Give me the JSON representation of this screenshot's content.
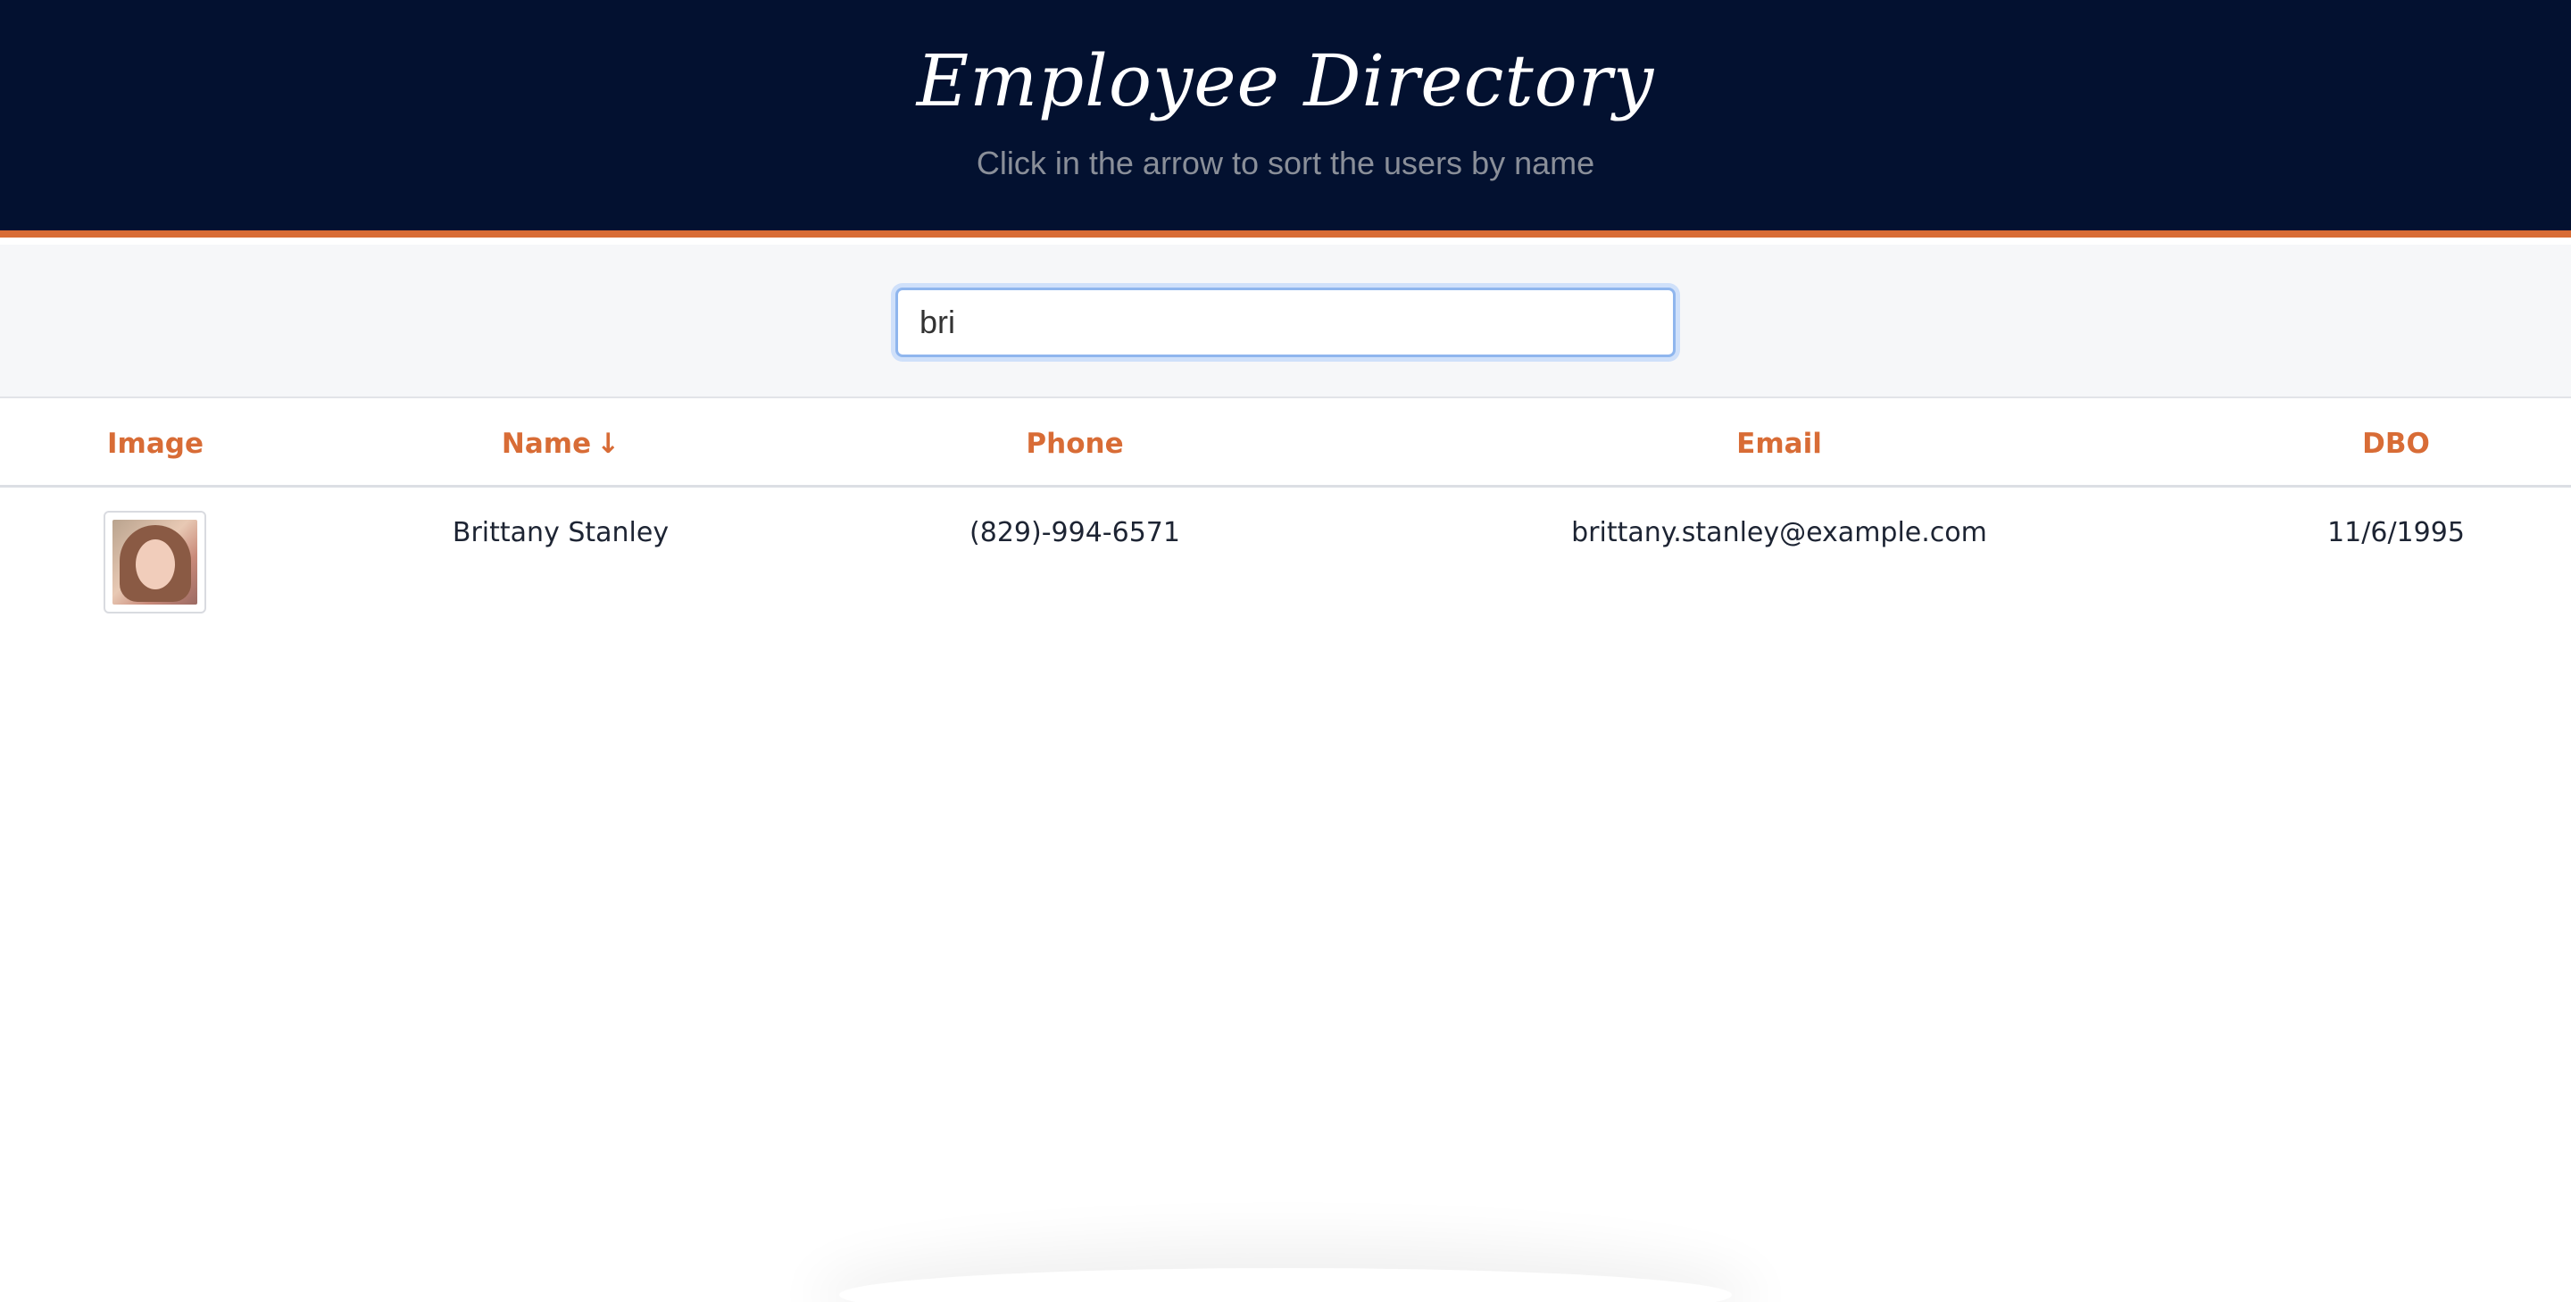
{
  "header": {
    "title": "Employee Directory",
    "subtitle": "Click in the arrow to sort the users by name"
  },
  "search": {
    "value": "bri"
  },
  "table": {
    "columns": [
      {
        "key": "image",
        "label": "Image"
      },
      {
        "key": "name",
        "label": "Name",
        "sort_icon": "arrow-down-icon"
      },
      {
        "key": "phone",
        "label": "Phone"
      },
      {
        "key": "email",
        "label": "Email"
      },
      {
        "key": "dob",
        "label": "DBO"
      }
    ],
    "rows": [
      {
        "image_icon": "employee-photo",
        "name": "Brittany Stanley",
        "phone": "(829)-994-6571",
        "email": "brittany.stanley@example.com",
        "dob": "11/6/1995"
      }
    ]
  },
  "colors": {
    "header_bg": "#031130",
    "accent": "#d86c36",
    "text": "#1d2433"
  }
}
